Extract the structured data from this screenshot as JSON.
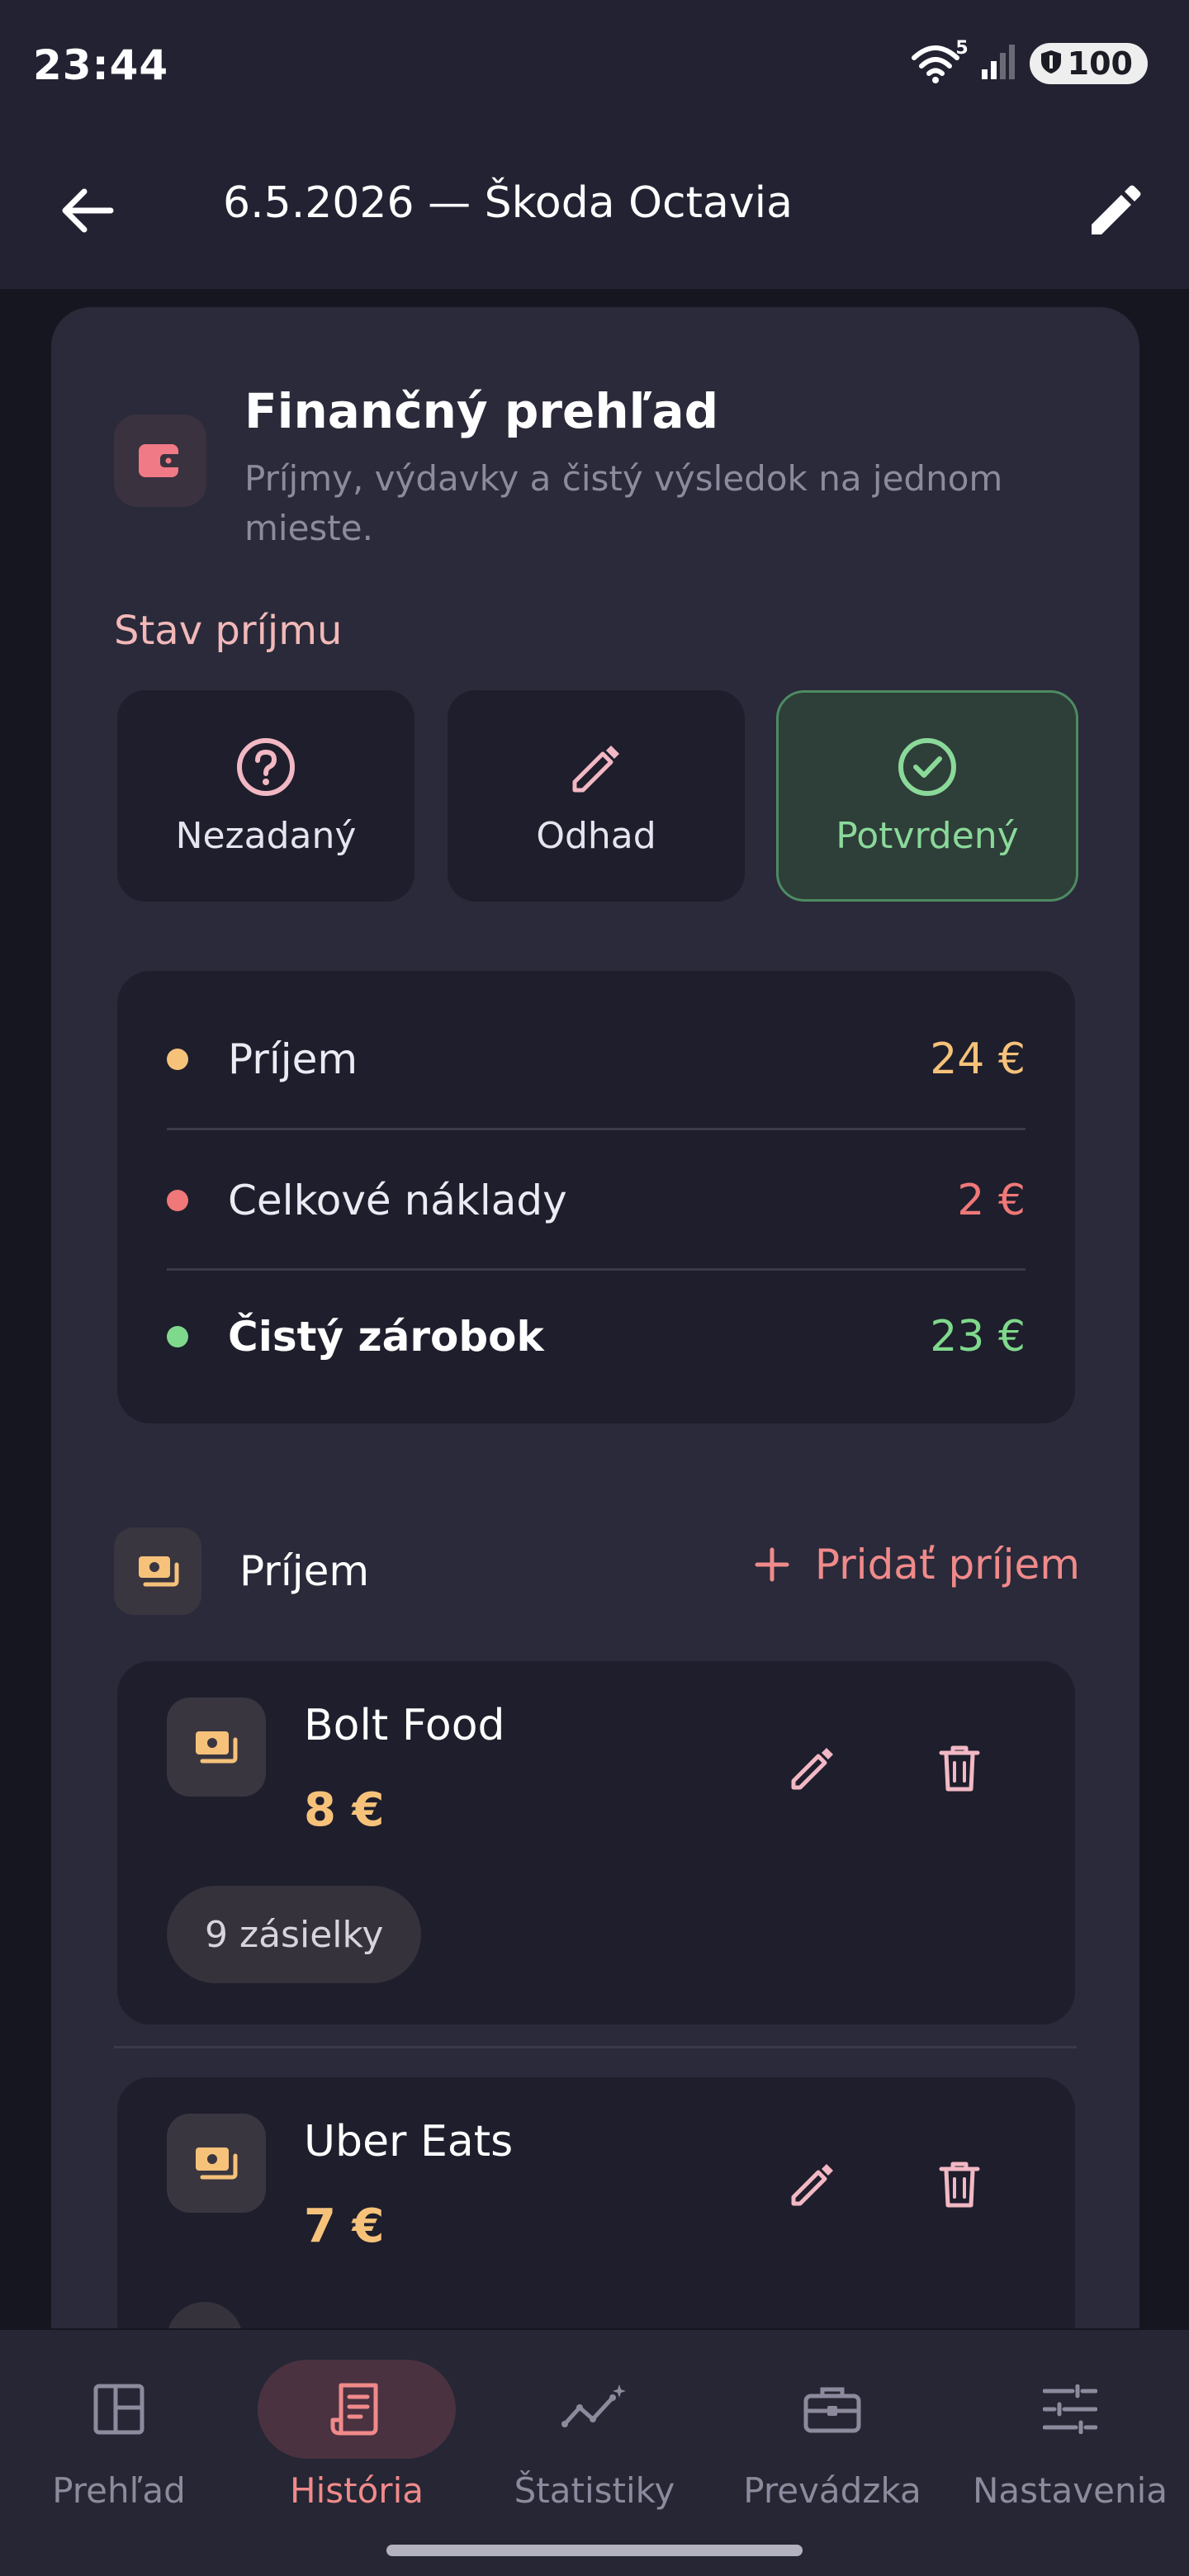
{
  "status_bar": {
    "time": "23:44",
    "wifi_badge": "5",
    "battery": "100"
  },
  "top_bar": {
    "title": "6.5.2026 — Škoda Octavia"
  },
  "finance": {
    "title": "Finančný prehľad",
    "subtitle": "Príjmy, výdavky a čistý výsledok na jednom mieste."
  },
  "income_status": {
    "label": "Stav príjmu",
    "options": [
      {
        "label": "Nezadaný",
        "icon": "question-circle-icon"
      },
      {
        "label": "Odhad",
        "icon": "pencil-icon"
      },
      {
        "label": "Potvrdený",
        "icon": "check-circle-icon",
        "selected": true
      }
    ]
  },
  "summary": {
    "rows": [
      {
        "label": "Príjem",
        "value": "24 €",
        "color": "#f6c27a"
      },
      {
        "label": "Celkové náklady",
        "value": "2 €",
        "color": "#f07878"
      },
      {
        "label": "Čistý zárobok",
        "value": "23 €",
        "color": "#7fd98c"
      }
    ]
  },
  "income_section": {
    "title": "Príjem",
    "add_label": "Pridať príjem",
    "entries": [
      {
        "name": "Bolt Food",
        "amount": "8 €",
        "badge": "9 zásielky"
      },
      {
        "name": "Uber Eats",
        "amount": "7 €",
        "badge": ""
      }
    ]
  },
  "bottom_nav": {
    "items": [
      {
        "label": "Prehľad",
        "icon": "dashboard-icon"
      },
      {
        "label": "História",
        "icon": "receipt-icon",
        "active": true
      },
      {
        "label": "Štatistiky",
        "icon": "sparkle-chart-icon"
      },
      {
        "label": "Prevádzka",
        "icon": "briefcase-icon"
      },
      {
        "label": "Nastavenia",
        "icon": "sliders-icon"
      }
    ]
  },
  "colors": {
    "accent": "#f08a8a",
    "income": "#f6c27a",
    "expense": "#f07878",
    "profit": "#7fd98c",
    "success_border": "#4e8a62"
  }
}
